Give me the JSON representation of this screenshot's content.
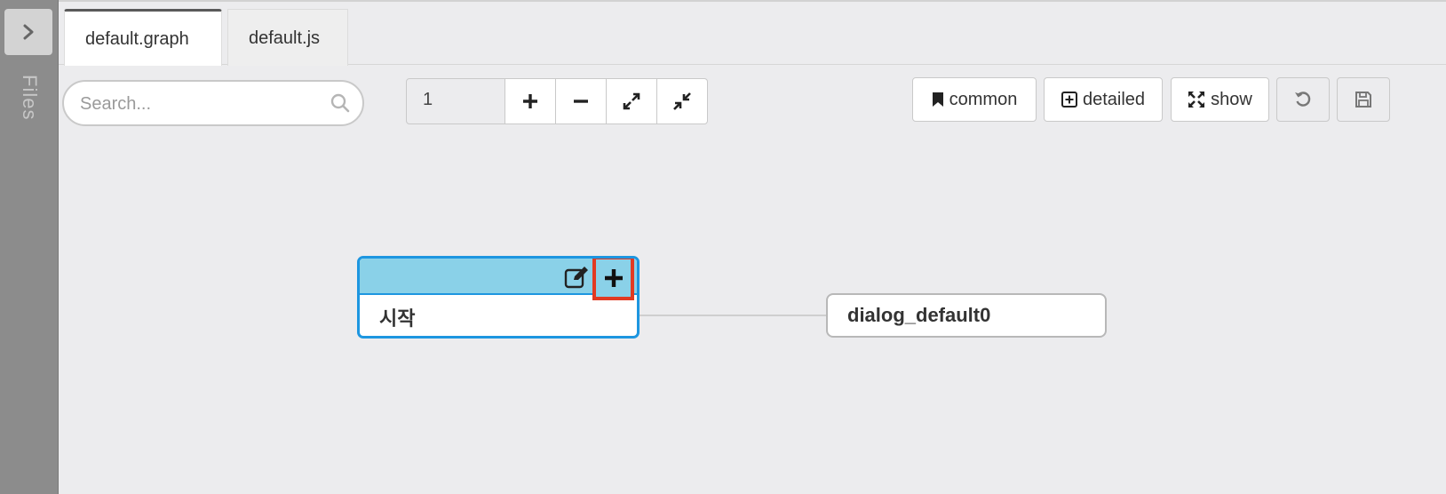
{
  "sidebar": {
    "label": "Files",
    "toggle_icon": "chevron-right-icon"
  },
  "tabs": [
    {
      "label": "default.graph",
      "active": true
    },
    {
      "label": "default.js",
      "active": false
    }
  ],
  "toolbar": {
    "search_placeholder": "Search...",
    "zoom_value": "1",
    "common_label": "common",
    "detailed_label": "detailed",
    "show_label": "show"
  },
  "graph": {
    "start_node_label": "시작",
    "dialog_node_label": "dialog_default0"
  },
  "colors": {
    "accent": "#1d96e0",
    "node_header": "#8ad1e8",
    "highlight": "#e23a22"
  }
}
